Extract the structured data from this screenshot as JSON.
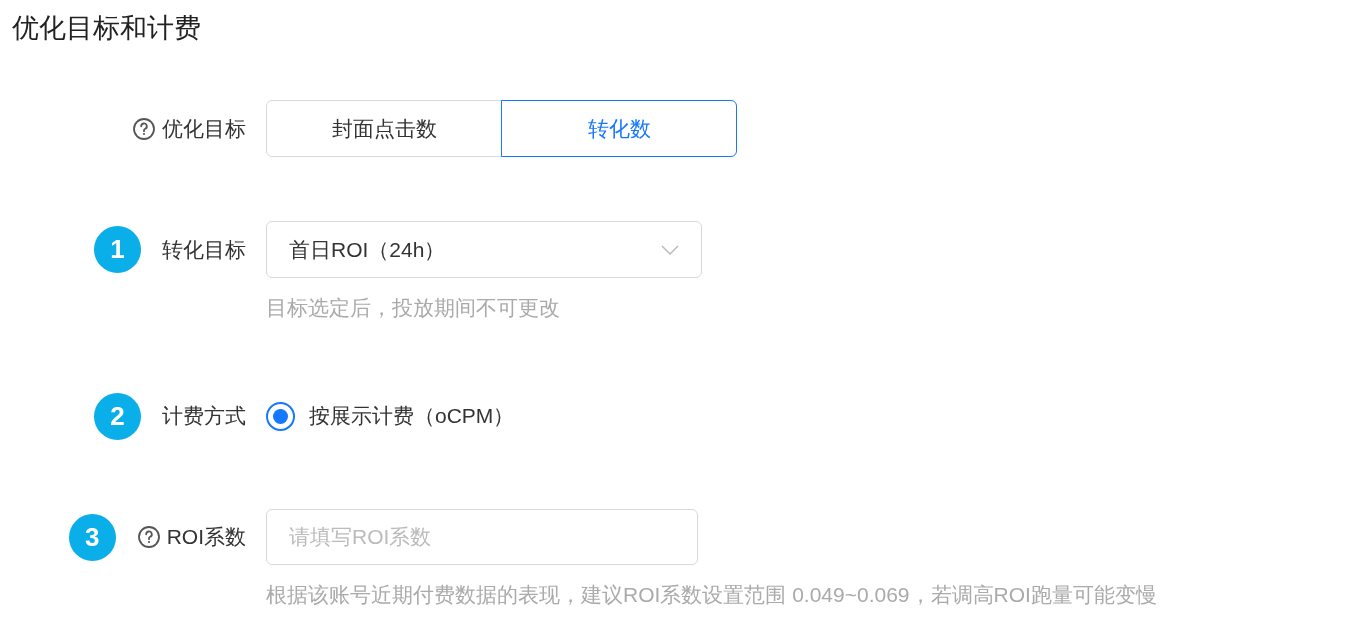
{
  "title": "优化目标和计费",
  "fields": [
    {
      "kind": "segmented",
      "help_icon": true,
      "label": "优化目标",
      "options": [
        {
          "label": "封面点击数",
          "selected": false
        },
        {
          "label": "转化数",
          "selected": true
        }
      ]
    },
    {
      "kind": "select",
      "marker": "1",
      "help_icon": false,
      "label": "转化目标",
      "value": "首日ROI（24h）",
      "note": "目标选定后，投放期间不可更改"
    },
    {
      "kind": "radio",
      "marker": "2",
      "help_icon": false,
      "label": "计费方式",
      "options": [
        {
          "label": "按展示计费（oCPM）",
          "selected": true
        }
      ]
    },
    {
      "kind": "input",
      "marker": "3",
      "help_icon": true,
      "label": "ROI系数",
      "placeholder": "请填写ROI系数",
      "note": "根据该账号近期付费数据的表现，建议ROI系数设置范围 0.049~0.069，若调高ROI跑量可能变慢"
    }
  ]
}
